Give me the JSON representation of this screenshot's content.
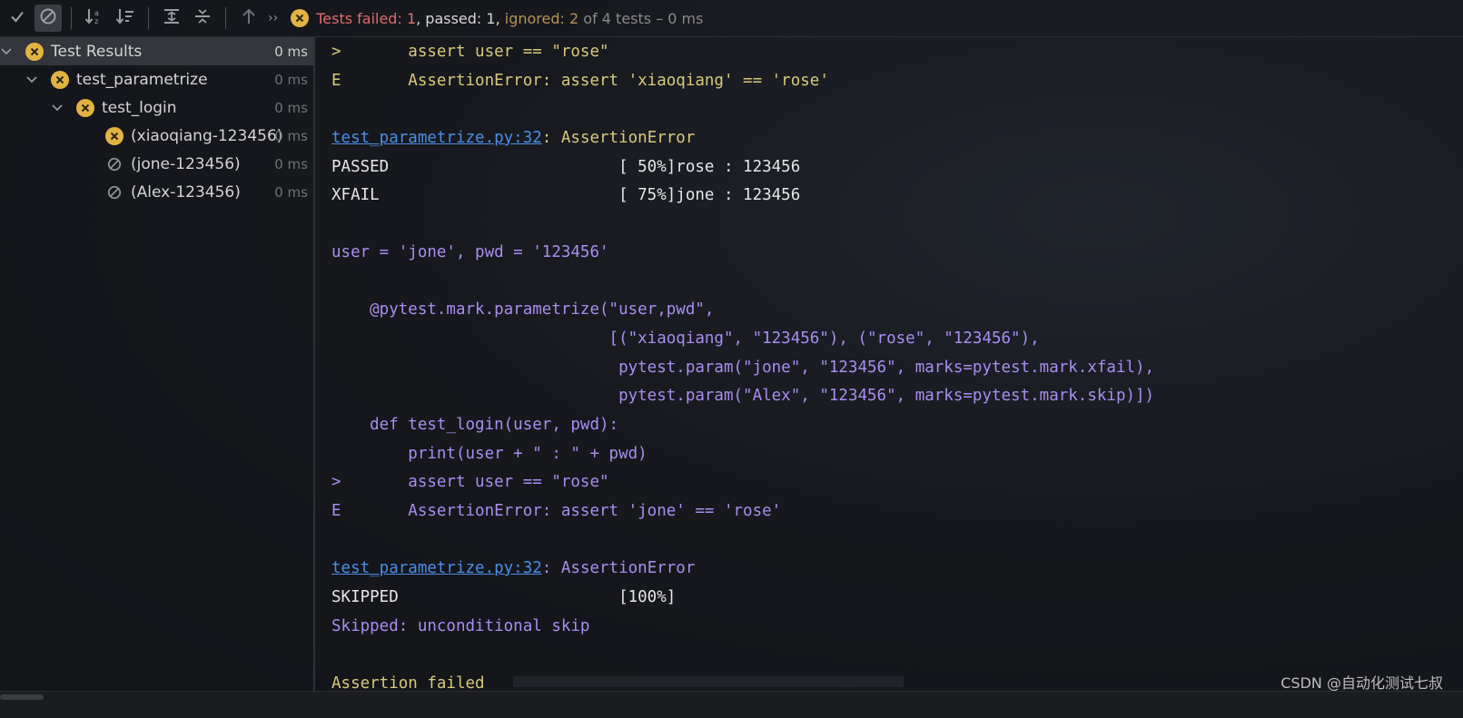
{
  "toolbar": {
    "buttons": [
      "show-passed",
      "show-ignored",
      "sort-alphabetically",
      "sort-by-duration",
      "expand-all",
      "collapse-all",
      "previous-failed"
    ],
    "status": {
      "failed": "Tests failed: 1",
      "sep1": ", ",
      "passed": "passed: 1",
      "sep2": ", ",
      "ignored": "ignored: 2",
      "rest": " of 4 tests – 0 ms"
    }
  },
  "tree": {
    "items": [
      {
        "label": "Test Results",
        "time": "0 ms",
        "icon": "failed-icon"
      },
      {
        "label": "test_parametrize",
        "time": "0 ms",
        "icon": "failed-icon"
      },
      {
        "label": "test_login",
        "time": "0 ms",
        "icon": "failed-icon"
      },
      {
        "label": "(xiaoqiang-123456)",
        "time": "0 ms",
        "icon": "failed-icon"
      },
      {
        "label": "(jone-123456)",
        "time": "0 ms",
        "icon": "ignored-icon"
      },
      {
        "label": "(Alex-123456)",
        "time": "0 ms",
        "icon": "ignored-icon"
      }
    ]
  },
  "console": {
    "lines": [
      ">       assert user == \"rose\"",
      "E       AssertionError: assert 'xiaoqiang' == 'rose'",
      "test_parametrize.py:32",
      ": AssertionError",
      "PASSED                        [ 50%]rose : 123456",
      "XFAIL                         [ 75%]jone : 123456",
      "user = 'jone', pwd = '123456'",
      "    @pytest.mark.parametrize(\"user,pwd\",",
      "                             [(\"xiaoqiang\", \"123456\"), (\"rose\", \"123456\"),",
      "                              pytest.param(\"jone\", \"123456\", marks=pytest.mark.xfail),",
      "                              pytest.param(\"Alex\", \"123456\", marks=pytest.mark.skip)])",
      "    def test_login(user, pwd):",
      "        print(user + \" : \" + pwd)",
      ">       assert user == \"rose\"",
      "E       AssertionError: assert 'jone' == 'rose'",
      "test_parametrize.py:32",
      ": AssertionError",
      "SKIPPED                       [100%]",
      "Skipped: unconditional skip",
      "Assertion failed"
    ]
  },
  "watermark": "CSDN @自动化测试七叔",
  "colors": {
    "failed": "#e06c6c",
    "ignored": "#b8925a",
    "failed_icon_bg": "#e3b341",
    "link": "#4a8fe7",
    "code_yellow": "#d9c97a",
    "code_purple": "#a98df0"
  }
}
